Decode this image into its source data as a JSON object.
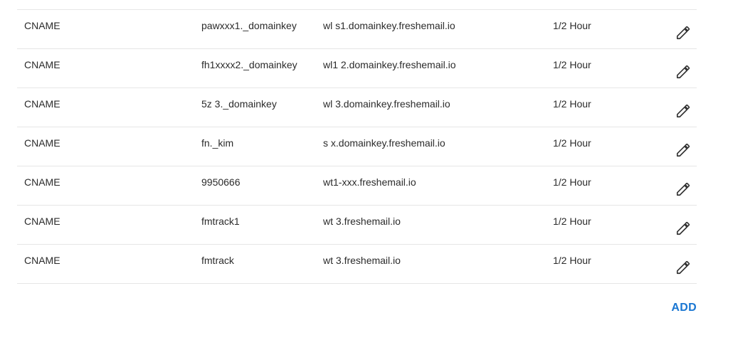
{
  "records": [
    {
      "type": "CNAME",
      "name": "pawxxx1._domainkey",
      "data": "wl      s1.domainkey.freshemail.io",
      "ttl": "1/2 Hour"
    },
    {
      "type": "CNAME",
      "name": "fh1xxxx2._domainkey",
      "data": "wl1      2.domainkey.freshemail.io",
      "ttl": "1/2 Hour"
    },
    {
      "type": "CNAME",
      "name": "5z       3._domainkey",
      "data": "wl        3.domainkey.freshemail.io",
      "ttl": "1/2 Hour"
    },
    {
      "type": "CNAME",
      "name": "fn._kim",
      "data": "s      x.domainkey.freshemail.io",
      "ttl": "1/2 Hour"
    },
    {
      "type": "CNAME",
      "name": "9950666",
      "data": "wt1-xxx.freshemail.io",
      "ttl": "1/2 Hour"
    },
    {
      "type": "CNAME",
      "name": "fmtrack1",
      "data": "wt        3.freshemail.io",
      "ttl": "1/2 Hour"
    },
    {
      "type": "CNAME",
      "name": "fmtrack",
      "data": "wt       3.freshemail.io",
      "ttl": "1/2 Hour"
    }
  ],
  "actions": {
    "add_label": "ADD",
    "edit_icon": "pencil-icon"
  },
  "colors": {
    "accent": "#1976d2",
    "divider": "#e6e6e6",
    "text": "#2b2b2b"
  }
}
